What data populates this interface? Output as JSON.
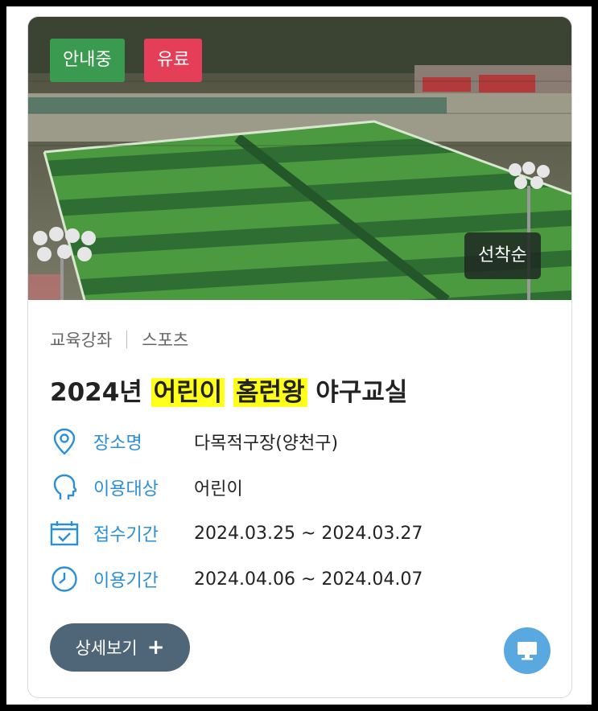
{
  "badges": {
    "status": "안내중",
    "fee": "유료",
    "method": "선착순"
  },
  "category": {
    "main": "교육강좌",
    "sub": "스포츠"
  },
  "title": {
    "prefix": "2024년 ",
    "highlight1": "어린이",
    "highlight2": "홈런왕",
    "suffix": " 야구교실"
  },
  "info": [
    {
      "icon": "location-pin-icon",
      "label": "장소명",
      "value": "다목적구장(양천구)"
    },
    {
      "icon": "person-head-icon",
      "label": "이용대상",
      "value": "어린이"
    },
    {
      "icon": "calendar-icon",
      "label": "접수기간",
      "value": "2024.03.25 ~ 2024.03.27"
    },
    {
      "icon": "clock-icon",
      "label": "이용기간",
      "value": "2024.04.06 ~ 2024.04.07"
    }
  ],
  "buttons": {
    "detail": "상세보기",
    "detail_icon": "+"
  },
  "colors": {
    "status_badge": "#3a9a4f",
    "fee_badge": "#e43e58",
    "accent": "#2a8fd8",
    "highlight": "#ffff19",
    "detail_button": "#4f6678",
    "online_button": "#5aa8e0"
  }
}
